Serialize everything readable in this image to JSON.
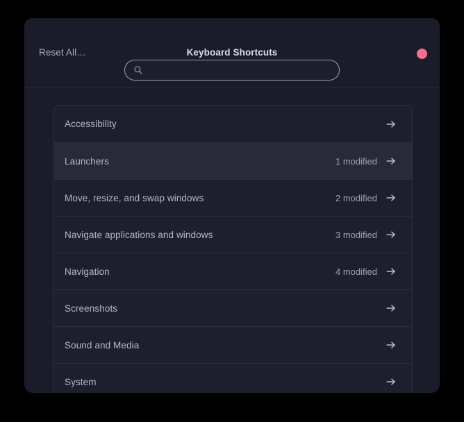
{
  "window": {
    "title": "Keyboard Shortcuts",
    "reset_all_label": "Reset All…",
    "close_icon": "close-circle-icon",
    "accent_close_color": "#f4718b",
    "background_color": "#1b1c2a"
  },
  "search": {
    "icon": "search-icon",
    "value": "",
    "placeholder": ""
  },
  "list": {
    "rows": [
      {
        "label": "Accessibility",
        "modified": "",
        "arrow": "arrow-right-icon",
        "hovered": false
      },
      {
        "label": "Launchers",
        "modified": "1 modified",
        "arrow": "arrow-right-icon",
        "hovered": true
      },
      {
        "label": "Move, resize, and swap windows",
        "modified": "2 modified",
        "arrow": "arrow-right-icon",
        "hovered": false
      },
      {
        "label": "Navigate applications and windows",
        "modified": "3 modified",
        "arrow": "arrow-right-icon",
        "hovered": false
      },
      {
        "label": "Navigation",
        "modified": "4 modified",
        "arrow": "arrow-right-icon",
        "hovered": false
      },
      {
        "label": "Screenshots",
        "modified": "",
        "arrow": "arrow-right-icon",
        "hovered": false
      },
      {
        "label": "Sound and Media",
        "modified": "",
        "arrow": "arrow-right-icon",
        "hovered": false
      },
      {
        "label": "System",
        "modified": "",
        "arrow": "arrow-right-icon",
        "hovered": false
      }
    ]
  }
}
